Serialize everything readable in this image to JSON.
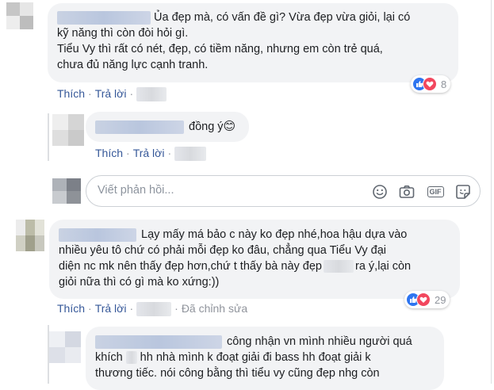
{
  "comments": [
    {
      "text_line1": "Ủa đẹp mà, có vấn đề gì? Vừa đẹp vừa giỏi, lại có",
      "text_line2": "kỹ năng thì còn đòi hỏi gì.",
      "text_line3": "Tiểu Vy thì rất có nét, đẹp, có tiềm năng, nhưng em còn trẻ quá,",
      "text_line4": "chưa đủ năng lực cạnh tranh.",
      "reaction_count": "8",
      "like_label": "Thích",
      "reply_label": "Trả lời"
    },
    {
      "text_line1": "Lạy mấy má bảo c này ko đẹp nhé,hoa hậu dựa vào",
      "text_line2": "nhiều yêu tô chứ có phải mỗi đẹp ko đâu, chẳng qua Tiểu Vy đại",
      "text_line3": "diện nc mk nên thấy đẹp hơn,chứ t thấy bà này đẹp",
      "text_line3b": "ra ý,lại còn",
      "text_line4": "giỏi nữa thì có gì mà ko xứng:))",
      "reaction_count": "29",
      "like_label": "Thích",
      "reply_label": "Trả lời",
      "edited_label": "Đã chỉnh sửa"
    }
  ],
  "replies": [
    {
      "text": "đồng ý",
      "emoji": "😊",
      "like_label": "Thích",
      "reply_label": "Trả lời"
    },
    {
      "text_line1": "công nhận vn mình nhiều người quá",
      "text_line2a": "khích",
      "text_line2b": "hh nhà mình k đoạt giải đi bass hh đoạt giải k",
      "text_line3": "thương tiếc. nói công bằng thì tiểu vy cũng đẹp nhg còn"
    }
  ],
  "reply_box": {
    "placeholder": "Viết phản hồi...",
    "gif_label": "GIF"
  },
  "colors": {
    "link": "#365899",
    "bubble": "#f2f3f5",
    "like": "#2e75f0",
    "love": "#f2475e"
  }
}
